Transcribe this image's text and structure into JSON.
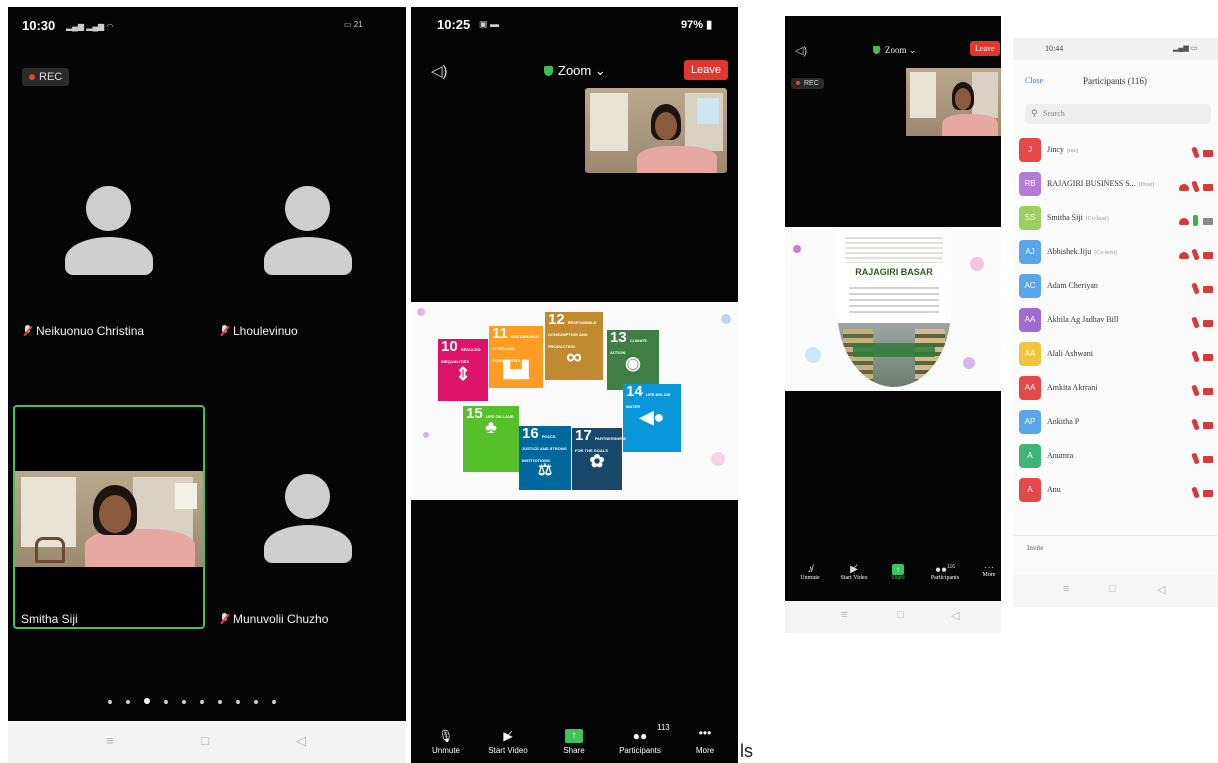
{
  "phone1": {
    "status_time": "10:30",
    "status_right": "21",
    "rec_label": "REC",
    "participants": [
      {
        "name": "Neikuonuo Christina",
        "muted": true
      },
      {
        "name": "Lhoulevinuo",
        "muted": true
      },
      {
        "name": "Smitha Siji",
        "muted": false,
        "video": true,
        "active_speaker": true
      },
      {
        "name": "Munuvolii Chuzho",
        "muted": true
      }
    ],
    "page_dots_count": 10,
    "page_dots_active": 3,
    "nav": {
      "menu": "≡",
      "home": "□",
      "back": "◁"
    }
  },
  "phone2": {
    "status_time": "10:25",
    "status_battery": "97%",
    "speaker_icon": "speaker-icon",
    "meeting_app": "Zoom",
    "leave_label": "Leave",
    "sdg_tiles": [
      {
        "num": "10",
        "text": "REDUCED INEQUALITIES",
        "color": "#dd1367"
      },
      {
        "num": "11",
        "text": "SUSTAINABLE CITIES AND COMMUNITIES",
        "color": "#fd9d24"
      },
      {
        "num": "12",
        "text": "RESPONSIBLE CONSUMPTION AND PRODUCTION",
        "color": "#bf8b2e"
      },
      {
        "num": "13",
        "text": "CLIMATE ACTION",
        "color": "#3f7e44"
      },
      {
        "num": "14",
        "text": "LIFE BELOW WATER",
        "color": "#0a97d9"
      },
      {
        "num": "15",
        "text": "LIFE ON LAND",
        "color": "#56c02b"
      },
      {
        "num": "16",
        "text": "PEACE, JUSTICE AND STRONG INSTITUTIONS",
        "color": "#00689d"
      },
      {
        "num": "17",
        "text": "PARTNERSHIPS FOR THE GOALS",
        "color": "#19486a"
      }
    ],
    "bottom_bar": [
      {
        "label": "Unmute",
        "icon": "mic-muted-icon"
      },
      {
        "label": "Start Video",
        "icon": "video-off-icon"
      },
      {
        "label": "Share",
        "icon": "share-icon"
      },
      {
        "label": "Participants",
        "icon": "participants-icon",
        "badge": "113"
      },
      {
        "label": "More",
        "icon": "more-icon"
      }
    ]
  },
  "stray_text": "ls",
  "phone3": {
    "meeting_app": "Zoom",
    "leave_label": "Leave",
    "rec_label": "REC",
    "slide_title": "RAJAGIRI BASAR",
    "bottom_bar": [
      {
        "label": "Unmute"
      },
      {
        "label": "Start Video"
      },
      {
        "label": "Share"
      },
      {
        "label": "Participants",
        "badge": "116"
      },
      {
        "label": "More"
      }
    ],
    "nav": {
      "menu": "≡",
      "home": "□",
      "back": "◁"
    }
  },
  "phone4": {
    "status_time": "10:44",
    "close_label": "Close",
    "title": "Participants (116)",
    "search_placeholder": "Search",
    "participants": [
      {
        "initials": "J",
        "name": "Jincy",
        "tag": "(me)",
        "color": "#e54848",
        "cloud": false,
        "mic": "muted",
        "cam": "off"
      },
      {
        "initials": "RB",
        "name": "RAJAGIRI BUSINESS S...",
        "tag": "(Host)",
        "color": "#b57bd6",
        "cloud": true,
        "mic": "muted",
        "cam": "off"
      },
      {
        "initials": "SS",
        "name": "Smitha Siji",
        "tag": "(Co-host)",
        "color": "#9ccf5c",
        "cloud": true,
        "mic": "on",
        "cam": "gray"
      },
      {
        "initials": "AJ",
        "name": "Abhishek Jiju",
        "tag": "(Co-host)",
        "color": "#5aa6e8",
        "cloud": true,
        "mic": "muted",
        "cam": "off"
      },
      {
        "initials": "AC",
        "name": "Adam Cheriyan",
        "tag": "",
        "color": "#5aa6e8",
        "cloud": false,
        "mic": "muted",
        "cam": "off"
      },
      {
        "initials": "AA",
        "name": "Akhila Ag Jadhav Bill",
        "tag": "",
        "color": "#a06bd1",
        "cloud": false,
        "mic": "muted",
        "cam": "off"
      },
      {
        "initials": "AA",
        "name": "Alali Ashwani",
        "tag": "",
        "color": "#f2c43a",
        "cloud": false,
        "mic": "muted",
        "cam": "off"
      },
      {
        "initials": "AA",
        "name": "Amkita Akrrani",
        "tag": "",
        "color": "#e54848",
        "cloud": false,
        "mic": "muted",
        "cam": "off"
      },
      {
        "initials": "AP",
        "name": "Ankitha P",
        "tag": "",
        "color": "#5aa6e8",
        "cloud": false,
        "mic": "muted",
        "cam": "off"
      },
      {
        "initials": "A",
        "name": "Anumra",
        "tag": "",
        "color": "#3fb57a",
        "cloud": false,
        "mic": "muted",
        "cam": "off"
      },
      {
        "initials": "A",
        "name": "Anu",
        "tag": "",
        "color": "#e54848",
        "cloud": false,
        "mic": "muted",
        "cam": "off"
      }
    ],
    "invite_label": "Invite",
    "nav": {
      "menu": "≡",
      "home": "□",
      "back": "◁"
    }
  }
}
